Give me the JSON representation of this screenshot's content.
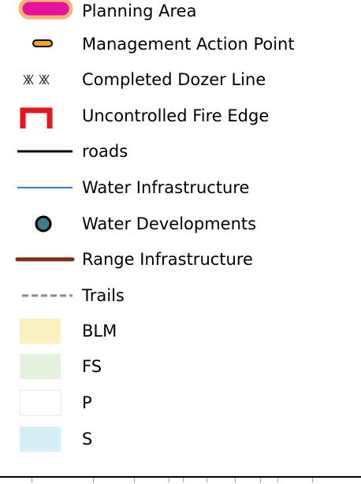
{
  "legend": {
    "items": [
      {
        "label": "Planning Area",
        "symbol": "pink-filled-polygon-icon"
      },
      {
        "label": "Management Action Point",
        "symbol": "orange-capsule-point-icon"
      },
      {
        "label": "Completed Dozer Line",
        "symbol": "dozer-line-hatch-icon"
      },
      {
        "label": "Uncontrolled Fire Edge",
        "symbol": "red-bracket-line-icon"
      },
      {
        "label": "roads",
        "symbol": "black-line-icon"
      },
      {
        "label": "Water Infrastructure",
        "symbol": "blue-line-icon"
      },
      {
        "label": "Water Developments",
        "symbol": "teal-circle-point-icon"
      },
      {
        "label": "Range Infrastructure",
        "symbol": "brown-line-icon"
      },
      {
        "label": "Trails",
        "symbol": "gray-dashed-line-icon"
      },
      {
        "label": "BLM",
        "symbol": "light-yellow-fill-icon"
      },
      {
        "label": "FS",
        "symbol": "light-green-fill-icon"
      },
      {
        "label": "P",
        "symbol": "white-fill-icon"
      },
      {
        "label": "S",
        "symbol": "light-blue-fill-icon"
      }
    ]
  },
  "colors": {
    "planning_area_fill": "#e8119b",
    "planning_area_outline": "#f2b477",
    "map_point_fill": "#f5a623",
    "fire_edge": "#e8141e",
    "roads": "#000000",
    "water_infrastructure": "#2f7fd6",
    "water_developments_fill": "#3b7f8c",
    "range_infrastructure": "#7a2e12",
    "trails": "#8a8a8a",
    "blm": "#fdf0c0",
    "fs": "#e2f2dd",
    "p": "#ffffff",
    "s": "#d6eef5"
  }
}
